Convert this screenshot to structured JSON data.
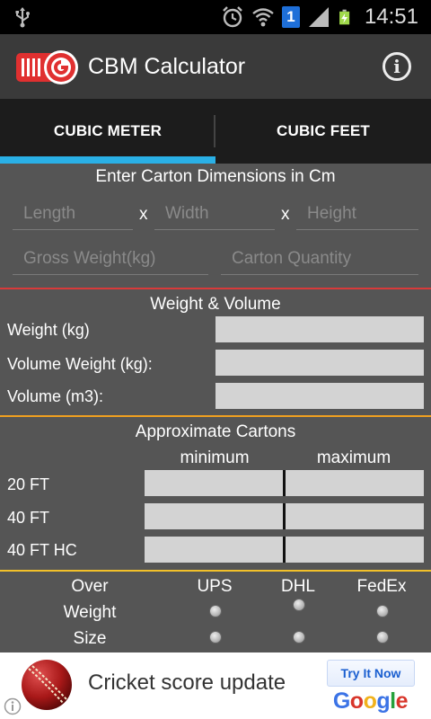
{
  "status_bar": {
    "time": "14:51",
    "notification_badge": "1",
    "icons": [
      "usb-icon",
      "alarm-icon",
      "wifi-icon",
      "signal-icon",
      "battery-charging-icon"
    ]
  },
  "app_bar": {
    "title": "CBM Calculator",
    "info_icon": "i"
  },
  "tabs": [
    {
      "label": "CUBIC METER",
      "selected": true
    },
    {
      "label": "CUBIC FEET",
      "selected": false
    }
  ],
  "dimensions": {
    "heading": "Enter Carton Dimensions in Cm",
    "length_placeholder": "Length",
    "width_placeholder": "Width",
    "height_placeholder": "Height",
    "times_symbol": "x",
    "gross_weight_placeholder": "Gross Weight(kg)",
    "carton_qty_placeholder": "Carton Quantity"
  },
  "weight_volume": {
    "heading": "Weight & Volume",
    "weight_label": "Weight (kg)",
    "volume_weight_label": "Volume Weight (kg):",
    "volume_label": "Volume (m3):"
  },
  "cartons": {
    "heading": "Approximate Cartons",
    "min_label": "minimum",
    "max_label": "maximum",
    "rows": [
      "20 FT",
      "40 FT",
      "40 FT HC"
    ]
  },
  "courier": {
    "over_label": "Over",
    "weight_label": "Weight",
    "size_label": "Size",
    "carriers": [
      "UPS",
      "DHL",
      "FedEx"
    ]
  },
  "ad": {
    "text": "Cricket score update",
    "button": "Try It Now",
    "brand": "Google"
  },
  "colors": {
    "accent_tab": "#2ab0e6",
    "divider_red": "#d93a3a",
    "divider_orange": "#f0a020",
    "divider_yellow": "#f2c02a"
  }
}
